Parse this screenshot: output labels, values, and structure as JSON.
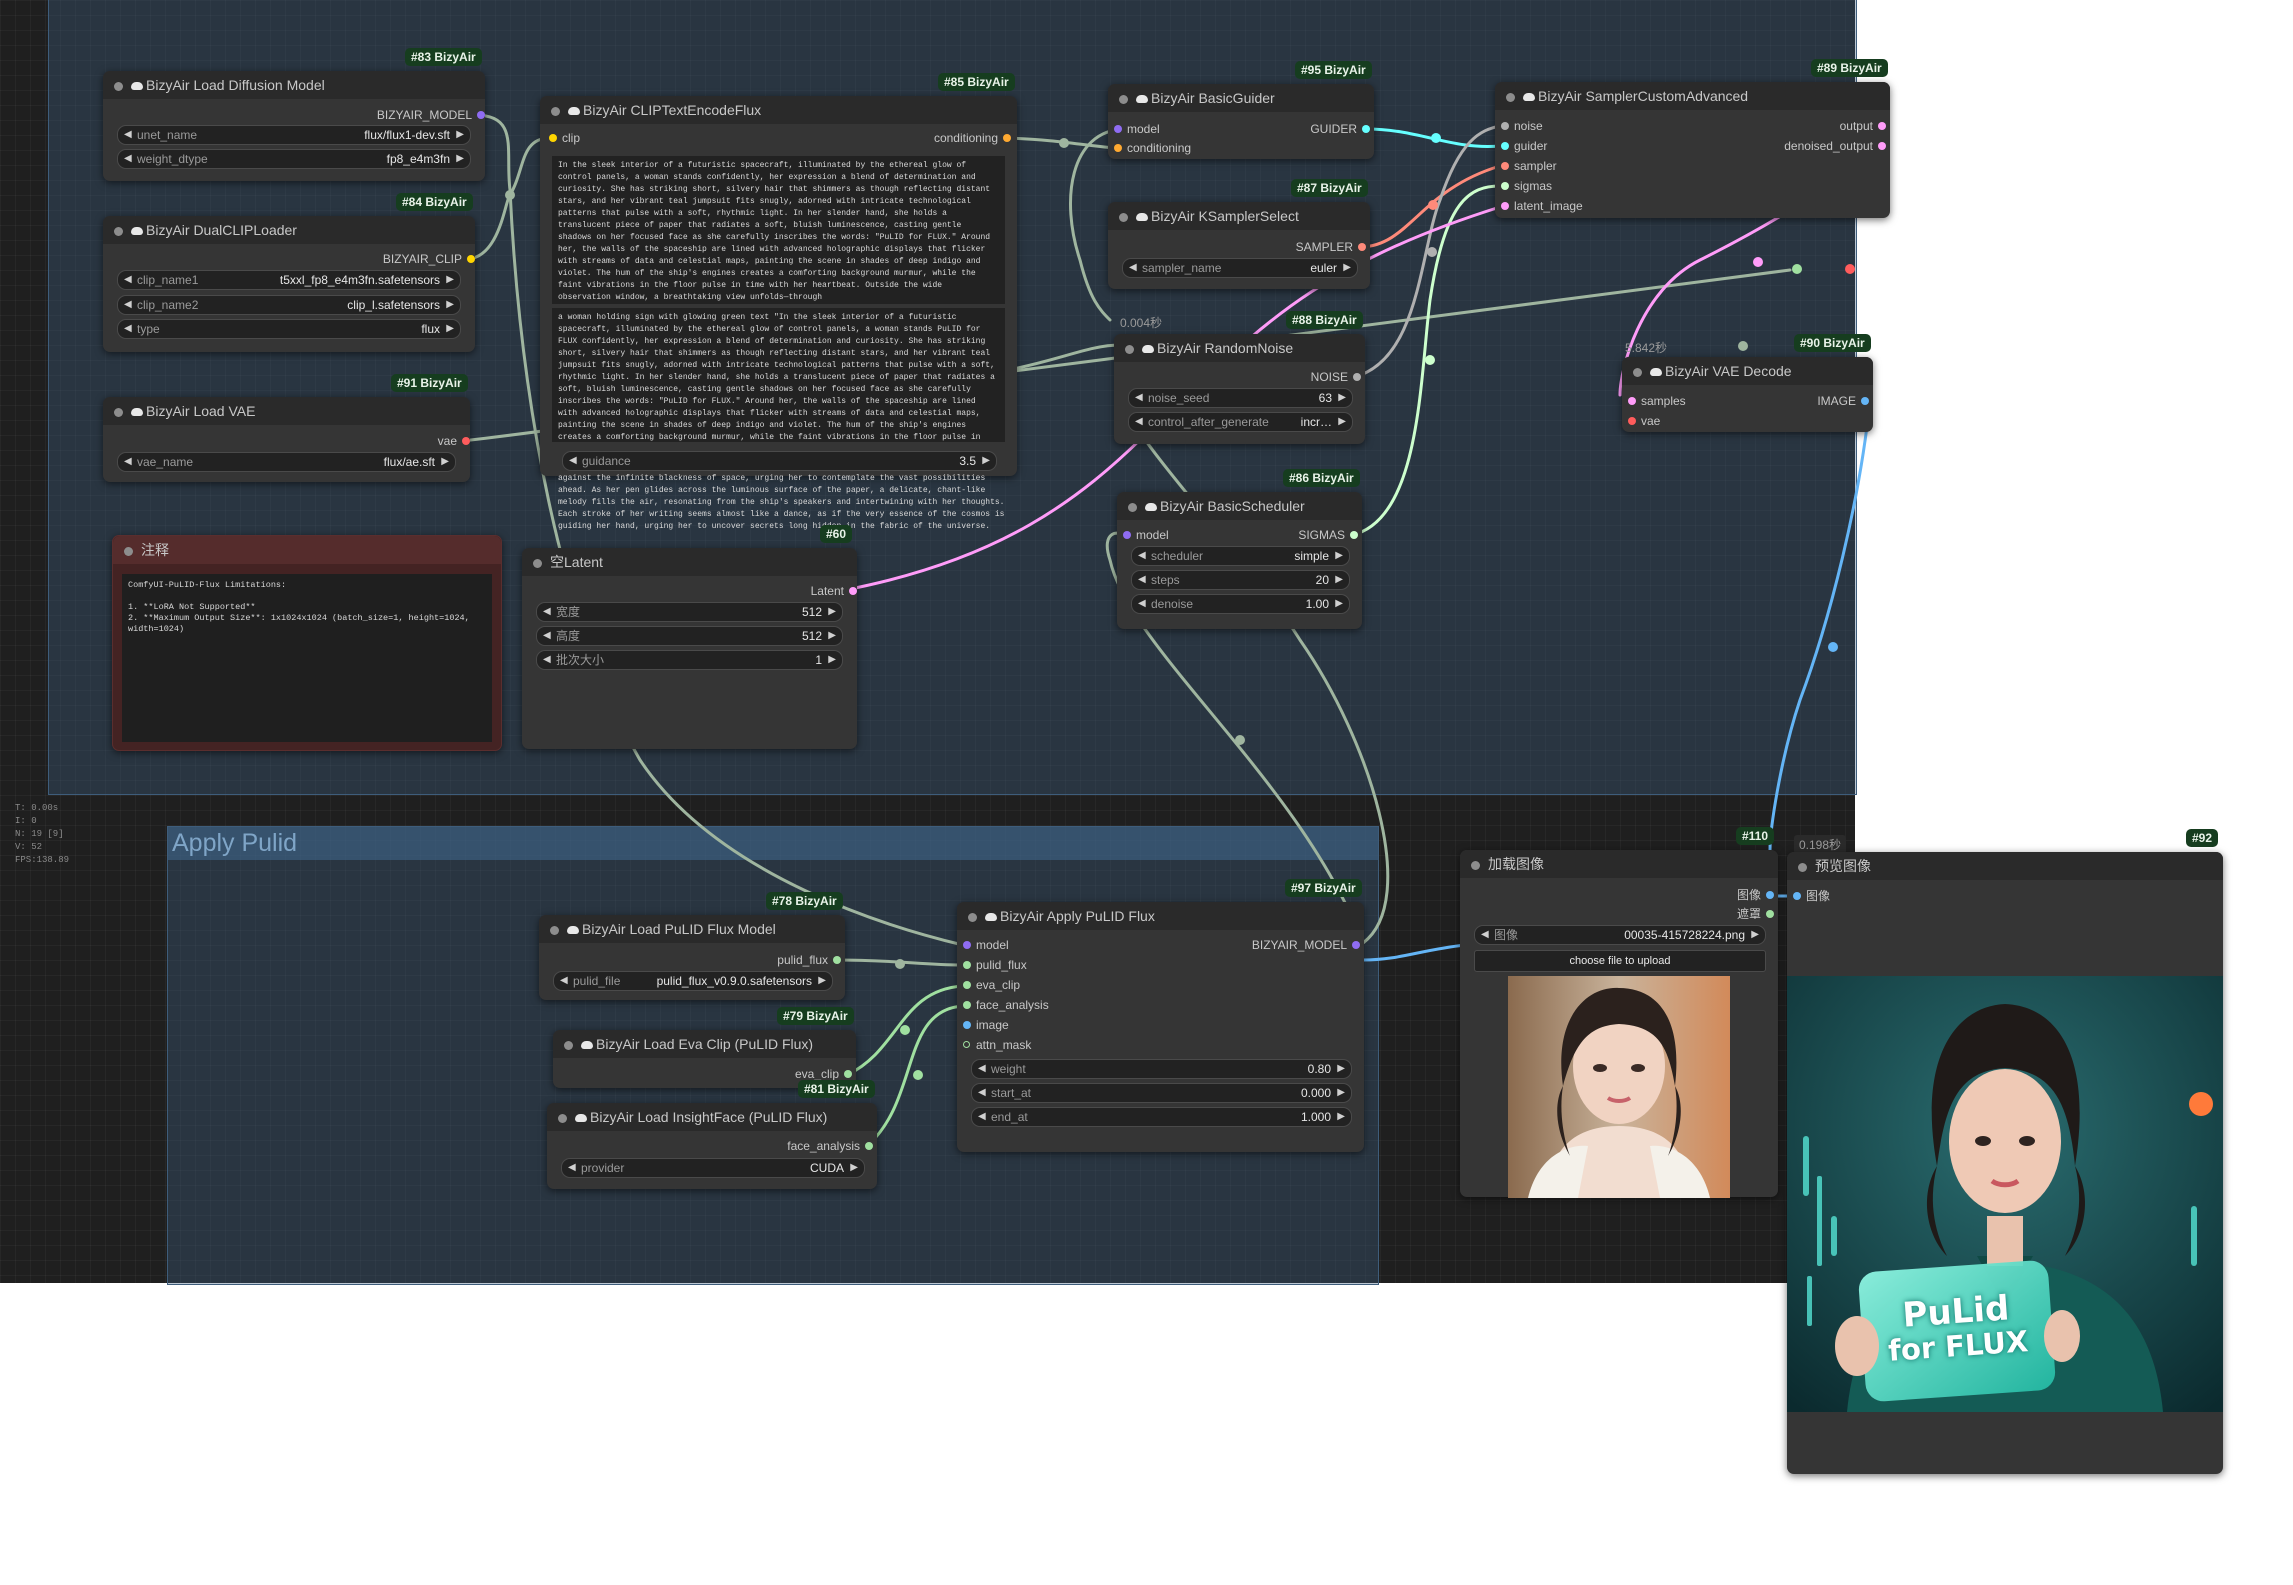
{
  "stats": {
    "t": "T: 0.00s",
    "i": "I: 0",
    "n": "N: 19 [9]",
    "v": "V: 52",
    "fps": "FPS:138.89"
  },
  "colors": {
    "model_pin": "#8f6cf2",
    "clip_pin": "#ffd500",
    "vae_pin": "#ff5c5c",
    "cond_pin": "#ffa931",
    "latent_pin": "#ff9cf9",
    "guider_pin": "#66ffff",
    "sigmas_pin": "#cdffcd",
    "image_pin": "#64b5f6",
    "sampler_pin": "#ff8a7a",
    "noise_pin": "#b0b0b0",
    "pulid_pin": "#a0e0a0"
  },
  "groups": {
    "apply_pulid": "Apply Pulid"
  },
  "nodes": {
    "n83": {
      "badge": "#83 BizyAir",
      "title": "BizyAir Load Diffusion Model",
      "output": "BIZYAIR_MODEL",
      "widgets": [
        {
          "label": "unet_name",
          "value": "flux/flux1-dev.sft"
        },
        {
          "label": "weight_dtype",
          "value": "fp8_e4m3fn"
        }
      ]
    },
    "n84": {
      "badge": "#84 BizyAir",
      "title": "BizyAir DualCLIPLoader",
      "output": "BIZYAIR_CLIP",
      "widgets": [
        {
          "label": "clip_name1",
          "value": "t5xxl_fp8_e4m3fn.safetensors"
        },
        {
          "label": "clip_name2",
          "value": "clip_l.safetensors"
        },
        {
          "label": "type",
          "value": "flux"
        }
      ]
    },
    "n91": {
      "badge": "#91 BizyAir",
      "title": "BizyAir Load VAE",
      "output": "vae",
      "widgets": [
        {
          "label": "vae_name",
          "value": "flux/ae.sft"
        }
      ]
    },
    "note": {
      "title": "注释",
      "text": "ComfyUI-PuLID-Flux Limitations:\n\n1. **LoRA Not Supported**\n2. **Maximum Output Size**: 1x1024x1024 (batch_size=1, height=1024,\nwidth=1024)"
    },
    "n85": {
      "badge": "#85 BizyAir",
      "title": "BizyAir CLIPTextEncodeFlux",
      "input": "clip",
      "output": "conditioning",
      "text1": "In the sleek interior of a futuristic spacecraft, illuminated by the ethereal glow of control panels, a woman stands confidently, her expression a blend of determination and curiosity. She has striking short, silvery hair that shimmers as though reflecting distant stars, and her vibrant teal jumpsuit fits snugly, adorned with intricate technological patterns that pulse with a soft, rhythmic light. In her slender hand, she holds a translucent piece of paper that radiates a soft, bluish luminescence, casting gentle shadows on her focused face as she carefully inscribes the words: \"PuLID for FLUX.\" Around her, the walls of the spaceship are lined with advanced holographic displays that flicker with streams of data and celestial maps, painting the scene in shades of deep indigo and violet. The hum of the ship's engines creates a comforting background murmur, while the faint vibrations in the floor pulse in time with her heartbeat. Outside the wide observation window, a breathtaking view unfolds—through",
      "text2": "a woman holding sign with glowing green text \"In the sleek interior of a futuristic spacecraft, illuminated by the ethereal glow of control panels, a woman stands PuLID for FLUX confidently, her expression a blend of determination and curiosity. She has striking short, silvery hair that shimmers as though reflecting distant stars, and her vibrant teal jumpsuit fits snugly, adorned with intricate technological patterns that pulse with a soft, rhythmic light. In her slender hand, she holds a translucent piece of paper that radiates a soft, bluish luminescence, casting gentle shadows on her focused face as she carefully inscribes the words: \"PuLID for FLUX.\" Around her, the walls of the spaceship are lined with advanced holographic displays that flicker with streams of data and celestial maps, painting the scene in shades of deep indigo and violet. The hum of the ship's engines creates a comforting background murmur, while the faint vibrations in the floor pulse in time with her heartbeat. Outside the wide observation window,",
      "overflow": "against the infinite blackness of space, urging her to contemplate the vast possibilities ahead. As her pen glides across the luminous surface of the paper, a delicate, chant-like melody fills the air, resonating from the ship's speakers and intertwining with her thoughts. Each stroke of her writing seems almost like a dance, as if the very essence of the cosmos is guiding her hand, urging her to uncover secrets long hidden in the fabric of the universe.",
      "widgets": [
        {
          "label": "guidance",
          "value": "3.5"
        }
      ]
    },
    "n60": {
      "badge": "#60",
      "title": "空Latent",
      "output": "Latent",
      "widgets": [
        {
          "label": "宽度",
          "value": "512"
        },
        {
          "label": "高度",
          "value": "512"
        },
        {
          "label": "批次大小",
          "value": "1"
        }
      ]
    },
    "n95": {
      "badge": "#95 BizyAir",
      "title": "BizyAir BasicGuider",
      "inputs": [
        "model",
        "conditioning"
      ],
      "output": "GUIDER"
    },
    "n87": {
      "badge": "#87 BizyAir",
      "title": "BizyAir KSamplerSelect",
      "output": "SAMPLER",
      "widgets": [
        {
          "label": "sampler_name",
          "value": "euler"
        }
      ]
    },
    "n88": {
      "badge": "#88 BizyAir",
      "time": "0.004秒",
      "title": "BizyAir RandomNoise",
      "output": "NOISE",
      "widgets": [
        {
          "label": "noise_seed",
          "value": "63"
        },
        {
          "label": "control_after_generate",
          "value": "incr…"
        }
      ]
    },
    "n86": {
      "badge": "#86 BizyAir",
      "title": "BizyAir BasicScheduler",
      "input": "model",
      "output": "SIGMAS",
      "widgets": [
        {
          "label": "scheduler",
          "value": "simple"
        },
        {
          "label": "steps",
          "value": "20"
        },
        {
          "label": "denoise",
          "value": "1.00"
        }
      ]
    },
    "n89": {
      "badge": "#89 BizyAir",
      "title": "BizyAir SamplerCustomAdvanced",
      "inputs": [
        "noise",
        "guider",
        "sampler",
        "sigmas",
        "latent_image"
      ],
      "outputs": [
        "output",
        "denoised_output"
      ]
    },
    "n90": {
      "badge": "#90 BizyAir",
      "time": "5.842秒",
      "title": "BizyAir VAE Decode",
      "inputs": [
        "samples",
        "vae"
      ],
      "output": "IMAGE"
    },
    "n78": {
      "badge": "#78 BizyAir",
      "title": "BizyAir Load PuLID Flux Model",
      "output": "pulid_flux",
      "widgets": [
        {
          "label": "pulid_file",
          "value": "pulid_flux_v0.9.0.safetensors"
        }
      ]
    },
    "n79": {
      "badge": "#79 BizyAir",
      "title": "BizyAir Load Eva Clip (PuLID Flux)",
      "output": "eva_clip"
    },
    "n81": {
      "badge": "#81 BizyAir",
      "title": "BizyAir Load InsightFace (PuLID Flux)",
      "output": "face_analysis",
      "widgets": [
        {
          "label": "provider",
          "value": "CUDA"
        }
      ]
    },
    "n97": {
      "badge": "#97 BizyAir",
      "title": "BizyAir Apply PuLID Flux",
      "inputs": [
        "model",
        "pulid_flux",
        "eva_clip",
        "face_analysis",
        "image",
        "attn_mask"
      ],
      "output": "BIZYAIR_MODEL",
      "widgets": [
        {
          "label": "weight",
          "value": "0.80"
        },
        {
          "label": "start_at",
          "value": "0.000"
        },
        {
          "label": "end_at",
          "value": "1.000"
        }
      ]
    },
    "n110": {
      "badge": "#110",
      "title": "加载图像",
      "outputs": [
        "图像",
        "遮罩"
      ],
      "widgets": [
        {
          "label": "图像",
          "value": "00035-415728224.png"
        }
      ],
      "upload": "choose file to upload"
    },
    "n92": {
      "badge": "#92",
      "time": "0.198秒",
      "title": "预览图像",
      "input": "图像"
    }
  },
  "preview_sign": {
    "line1": "PuLid",
    "line2": "for FLUX"
  }
}
